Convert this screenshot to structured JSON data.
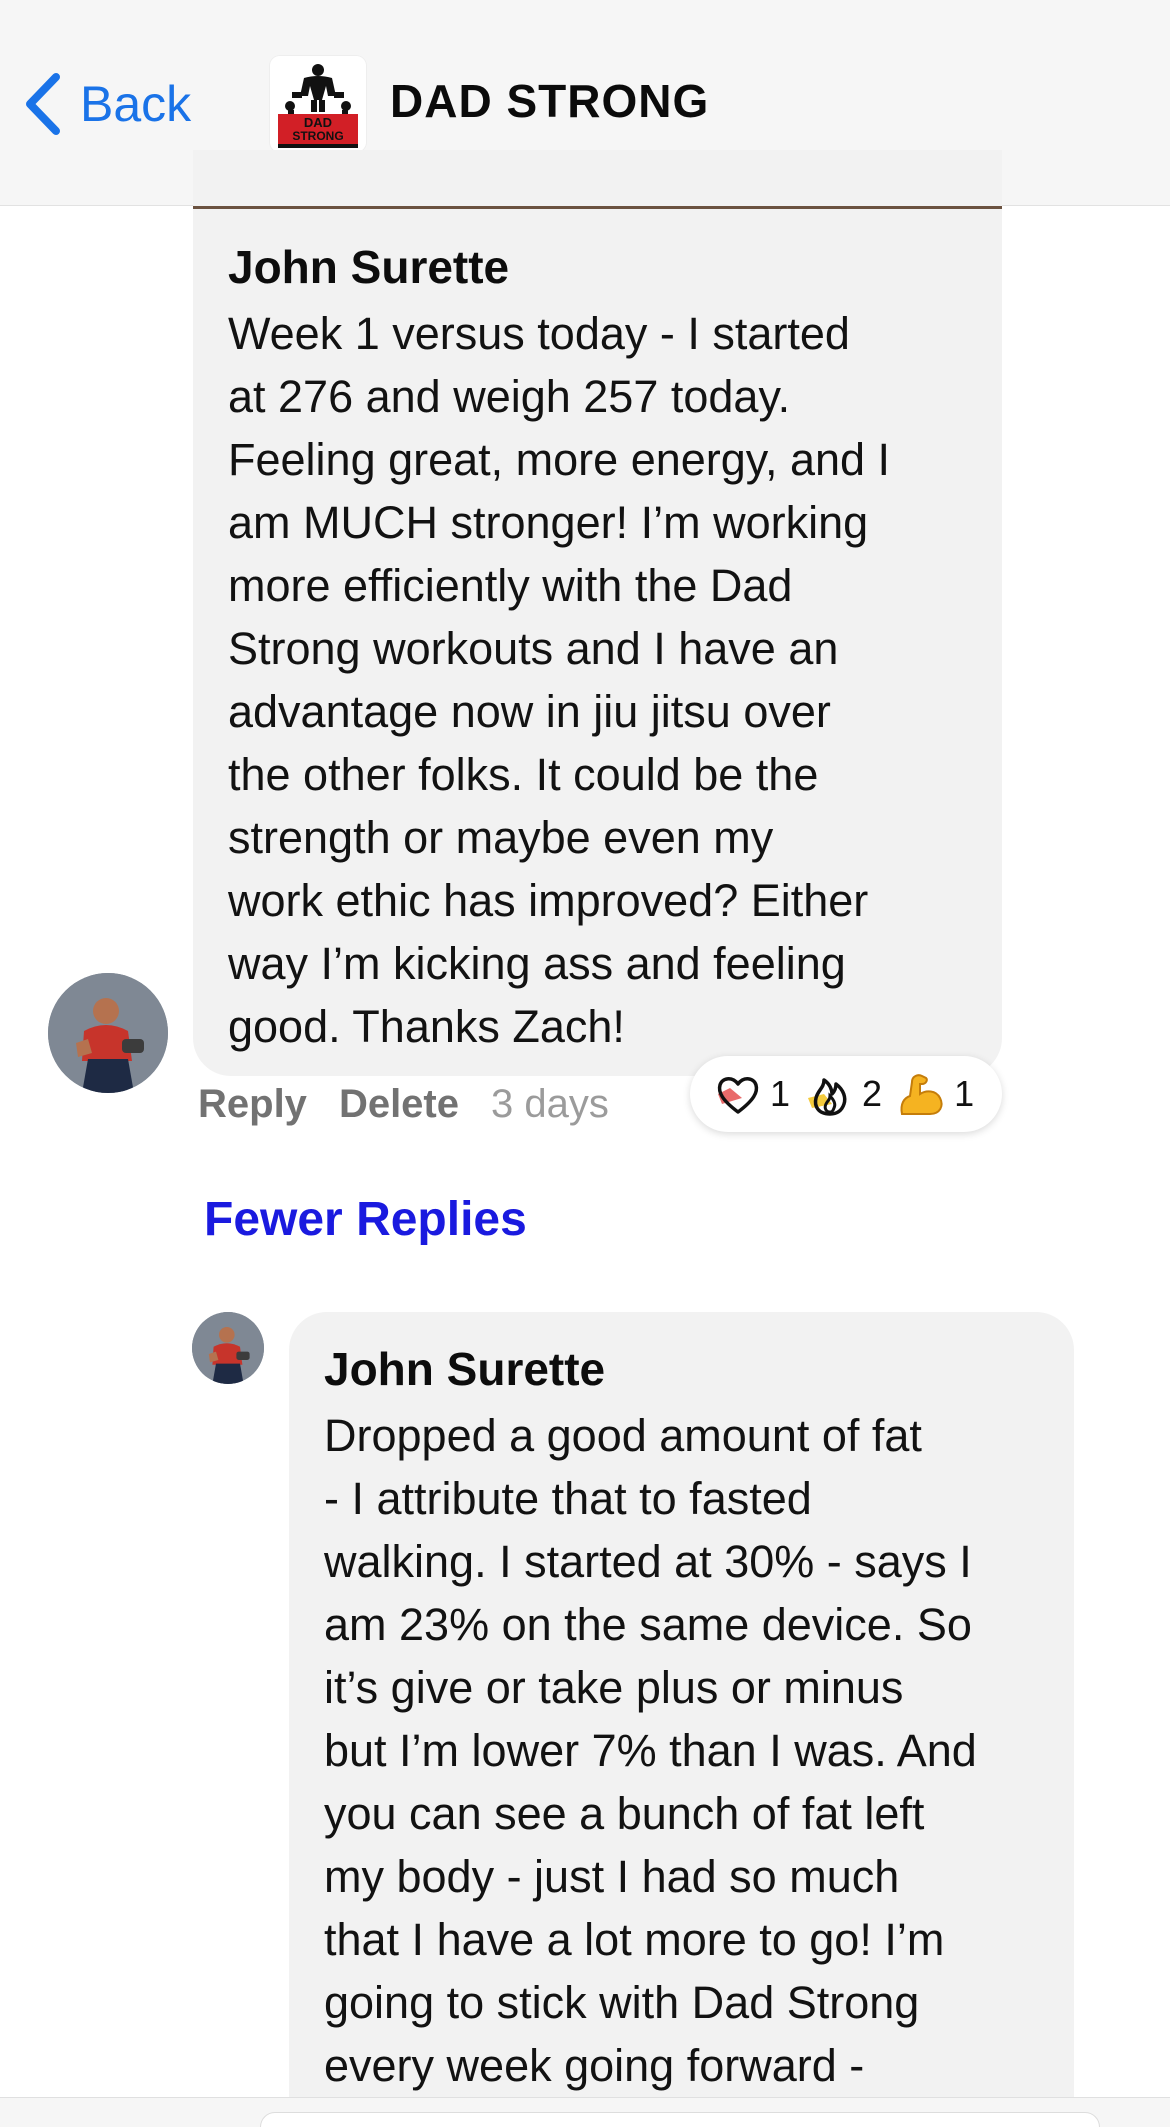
{
  "header": {
    "back_label": "Back",
    "group_title": "DAD STRONG",
    "logo_icon": "dad-strong-logo",
    "logo_text_line1": "DAD",
    "logo_text_line2": "STRONG"
  },
  "comments": [
    {
      "author": "John Surette",
      "text": "Week 1 versus today - I started\nat 276 and weigh 257 today.\nFeeling great, more energy, and I\nam MUCH stronger! I’m working\nmore efficiently with the Dad\nStrong workouts and I have an\nadvantage now in jiu jitsu over\nthe other folks. It could be the\nstrength or maybe even my\nwork ethic has improved? Either\nway I’m kicking ass and feeling\ngood. Thanks Zach!",
      "actions": {
        "reply": "Reply",
        "delete": "Delete",
        "time": "3 days"
      },
      "reactions": [
        {
          "icon": "heart-icon",
          "count": "1"
        },
        {
          "icon": "fire-icon",
          "count": "2"
        },
        {
          "icon": "flexed-bicep-icon",
          "count": "1"
        }
      ]
    },
    {
      "author": "John Surette",
      "text": "Dropped a good amount of fat\n- I attribute that to fasted\nwalking. I started at 30% - says I\nam 23% on the same device. So\nit’s give or take plus or minus\nbut I’m lower 7% than I was. And\nyou can see a bunch of fat left\nmy body - just I had so much\nthat I have a lot more to go! I’m\ngoing to stick with Dad Strong\nevery week going forward -"
    }
  ],
  "fewer_replies_label": "Fewer Replies",
  "colors": {
    "accent_blue": "#1a73e8",
    "link_blue": "#1a1adf",
    "bubble_bg": "#f2f2f2",
    "header_bg": "#f6f6f6"
  }
}
